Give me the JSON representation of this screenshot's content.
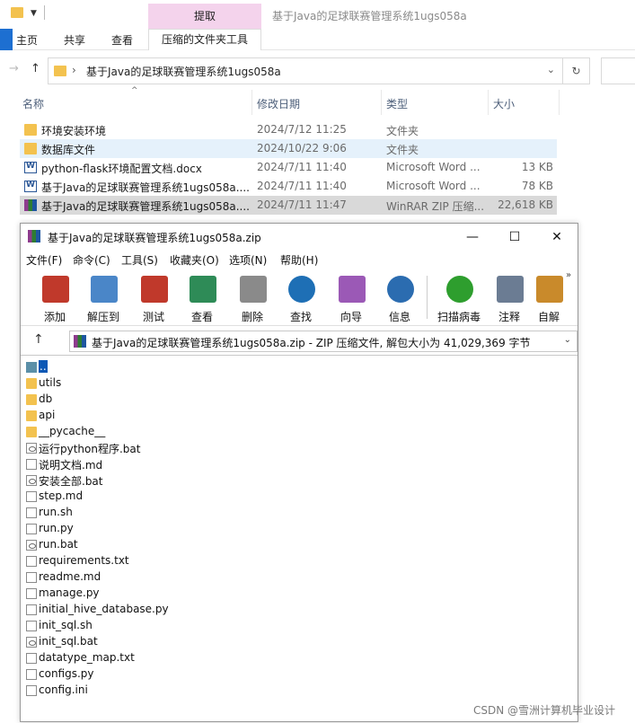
{
  "explorer": {
    "title": "基于Java的足球联赛管理系统1ugs058a",
    "extract_tab": "提取",
    "ribbon_tabs": [
      "主页",
      "共享",
      "查看"
    ],
    "ribbon_active_tab": "压缩的文件夹工具",
    "address": "基于Java的足球联赛管理系统1ugs058a",
    "columns": {
      "name": "名称",
      "date": "修改日期",
      "type": "类型",
      "size": "大小"
    },
    "files": [
      {
        "name": "环境安装环境",
        "date": "2024/7/12 11:25",
        "type": "文件夹",
        "size": "",
        "icon": "folder-icon"
      },
      {
        "name": "数据库文件",
        "date": "2024/10/22 9:06",
        "type": "文件夹",
        "size": "",
        "icon": "folder-icon"
      },
      {
        "name": "python-flask环境配置文档.docx",
        "date": "2024/7/11 11:40",
        "type": "Microsoft Word ...",
        "size": "13 KB",
        "icon": "word-doc-icon"
      },
      {
        "name": "基于Java的足球联赛管理系统1ugs058a....",
        "date": "2024/7/11 11:40",
        "type": "Microsoft Word ...",
        "size": "78 KB",
        "icon": "word-doc-icon"
      },
      {
        "name": "基于Java的足球联赛管理系统1ugs058a....",
        "date": "2024/7/11 11:47",
        "type": "WinRAR ZIP 压缩...",
        "size": "22,618 KB",
        "icon": "winrar-archive-icon"
      }
    ]
  },
  "winrar": {
    "title": "基于Java的足球联赛管理系统1ugs058a.zip",
    "win_buttons": {
      "minimize": "—",
      "maximize": "☐",
      "close": "✕"
    },
    "menu": [
      "文件(F)",
      "命令(C)",
      "工具(S)",
      "收藏夹(O)",
      "选项(N)",
      "帮助(H)"
    ],
    "toolbar": [
      {
        "label": "添加",
        "icon": "add-icon",
        "color": "#c0392b"
      },
      {
        "label": "解压到",
        "icon": "extract-to-icon",
        "color": "#4a86c8"
      },
      {
        "label": "测试",
        "icon": "test-icon",
        "color": "#c0392b"
      },
      {
        "label": "查看",
        "icon": "view-icon",
        "color": "#2e8b57"
      },
      {
        "label": "删除",
        "icon": "delete-icon",
        "color": "#8a8a8a"
      },
      {
        "label": "查找",
        "icon": "find-icon",
        "color": "#1e6fb5"
      },
      {
        "label": "向导",
        "icon": "wizard-icon",
        "color": "#9b59b6"
      },
      {
        "label": "信息",
        "icon": "info-icon",
        "color": "#2b6cb0"
      },
      {
        "label": "扫描病毒",
        "icon": "scan-virus-icon",
        "color": "#2e9e2e"
      },
      {
        "label": "注释",
        "icon": "comment-icon",
        "color": "#6b7c93"
      },
      {
        "label": "自解",
        "icon": "sfx-icon",
        "color": "#c98a2b"
      }
    ],
    "toolbar_more": "»",
    "path": "基于Java的足球联赛管理系统1ugs058a.zip - ZIP 压缩文件, 解包大小为 41,029,369 字节",
    "items": [
      {
        "name": "..",
        "icon": "up"
      },
      {
        "name": "utils",
        "icon": "folder"
      },
      {
        "name": "db",
        "icon": "folder"
      },
      {
        "name": "api",
        "icon": "folder"
      },
      {
        "name": "__pycache__",
        "icon": "folder"
      },
      {
        "name": "运行python程序.bat",
        "icon": "bat"
      },
      {
        "name": "说明文档.md",
        "icon": "file"
      },
      {
        "name": "安装全部.bat",
        "icon": "bat"
      },
      {
        "name": "step.md",
        "icon": "file"
      },
      {
        "name": "run.sh",
        "icon": "file"
      },
      {
        "name": "run.py",
        "icon": "file"
      },
      {
        "name": "run.bat",
        "icon": "bat"
      },
      {
        "name": "requirements.txt",
        "icon": "file"
      },
      {
        "name": "readme.md",
        "icon": "file"
      },
      {
        "name": "manage.py",
        "icon": "file"
      },
      {
        "name": "initial_hive_database.py",
        "icon": "file"
      },
      {
        "name": "init_sql.sh",
        "icon": "file"
      },
      {
        "name": "init_sql.bat",
        "icon": "bat"
      },
      {
        "name": "datatype_map.txt",
        "icon": "file"
      },
      {
        "name": "configs.py",
        "icon": "file"
      },
      {
        "name": "config.ini",
        "icon": "file"
      }
    ]
  },
  "watermark": "CSDN @雪洲计算机毕业设计"
}
